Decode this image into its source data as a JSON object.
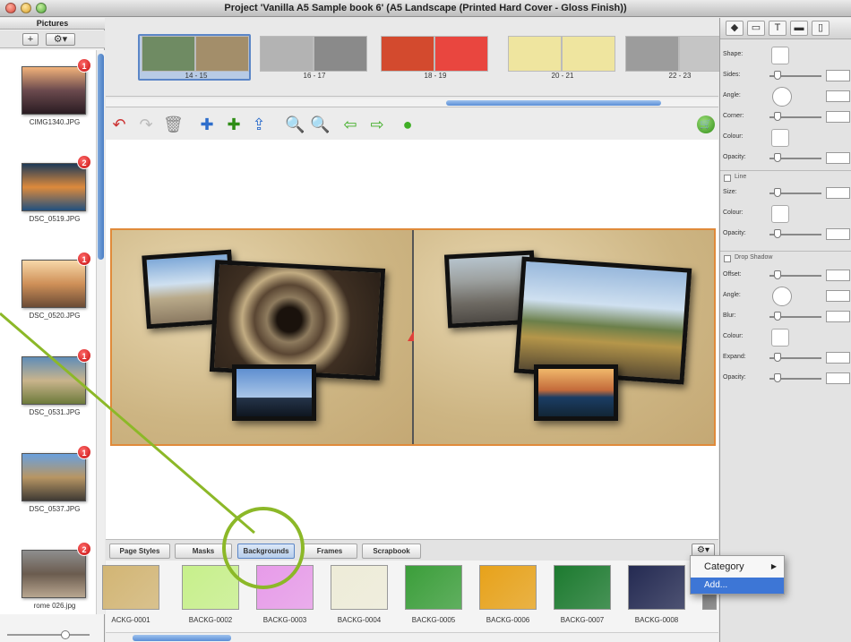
{
  "window": {
    "title": "Project 'Vanilla A5 Sample book 6' (A5 Landscape (Printed Hard Cover - Gloss Finish))"
  },
  "pictures_panel": {
    "header": "Pictures",
    "add_button": "+",
    "menu_button": "⚙▾",
    "items": [
      {
        "name": "CIMG1340.JPG",
        "count": "1",
        "colors": [
          "#f2b27a",
          "#6b4a4e",
          "#2a1c22"
        ]
      },
      {
        "name": "DSC_0519.JPG",
        "count": "2",
        "colors": [
          "#1d3a58",
          "#dd8a3c",
          "#22507e"
        ]
      },
      {
        "name": "DSC_0520.JPG",
        "count": "1",
        "colors": [
          "#f7d8a9",
          "#cf9058",
          "#6b4b36"
        ]
      },
      {
        "name": "DSC_0531.JPG",
        "count": "1",
        "colors": [
          "#5f8db8",
          "#c9b48c",
          "#6d7a3b"
        ]
      },
      {
        "name": "DSC_0537.JPG",
        "count": "1",
        "colors": [
          "#6aa0de",
          "#b89664",
          "#3f3a34"
        ]
      },
      {
        "name": "rome 026.jpg",
        "count": "2",
        "colors": [
          "#8e8e8e",
          "#6b5c4f",
          "#b8a690"
        ]
      }
    ]
  },
  "spreads": [
    {
      "label": "14 - 15",
      "colors": [
        "#6f8b63",
        "#a38e6a"
      ]
    },
    {
      "label": "16 - 17",
      "colors": [
        "#b3b3b3",
        "#8a8a8a"
      ]
    },
    {
      "label": "18 - 19",
      "colors": [
        "#d34a2e",
        "#e9463f"
      ]
    },
    {
      "label": "20 - 21",
      "colors": [
        "#efe59f",
        "#efe59f"
      ]
    },
    {
      "label": "22 - 23",
      "colors": [
        "#9c9c9c",
        "#c5c5c5"
      ]
    }
  ],
  "toolbar": {
    "icons": [
      "undo-icon",
      "redo-icon",
      "trash-icon",
      "add-page-icon",
      "insert-page-icon",
      "move-page-icon",
      "zoom-out-icon",
      "zoom-in-icon",
      "back-arrow-icon",
      "forward-arrow-icon",
      "info-icon"
    ],
    "cart_icon": "cart-icon"
  },
  "tabs": [
    {
      "label": "Page Styles"
    },
    {
      "label": "Masks"
    },
    {
      "label": "Backgrounds"
    },
    {
      "label": "Frames"
    },
    {
      "label": "Scrapbook"
    }
  ],
  "gear_menu": "⚙▾",
  "backgrounds": [
    {
      "name": "ACKG-0001",
      "color": "#d2b574"
    },
    {
      "name": "BACKG-0002",
      "color": "#c7f08b"
    },
    {
      "name": "BACKG-0003",
      "color": "#e79be9"
    },
    {
      "name": "BACKG-0004",
      "color": "#eeecd8"
    },
    {
      "name": "BACKG-0005",
      "color": "#3b9e3a"
    },
    {
      "name": "BACKG-0006",
      "color": "#e7a21a"
    },
    {
      "name": "BACKG-0007",
      "color": "#1c7a2f"
    },
    {
      "name": "BACKG-0008",
      "color": "#242a52"
    },
    {
      "name": "B",
      "color": "#777777"
    }
  ],
  "popup_menu": {
    "category": "Category",
    "add": "Add..."
  },
  "inspector": {
    "tab_icons": [
      "shape-icon",
      "layout-icon",
      "text-icon",
      "ruler-icon",
      "page-icon"
    ],
    "tab_text": "T",
    "props_shape": [
      "Shape:",
      "Sides:",
      "Angle:",
      "Corner:",
      "Colour:",
      "Opacity:"
    ],
    "line_title": "Line",
    "props_line": [
      "Size:",
      "Colour:",
      "Opacity:"
    ],
    "shadow_title": "Drop Shadow",
    "props_shadow": [
      "Offset:",
      "Angle:",
      "Blur:",
      "Colour:",
      "Expand:",
      "Opacity:"
    ]
  },
  "colors": {
    "accent": "#5b86c7",
    "badge": "#c50d0d",
    "book_border": "#e08a3a",
    "annotation": "#8cb828"
  }
}
